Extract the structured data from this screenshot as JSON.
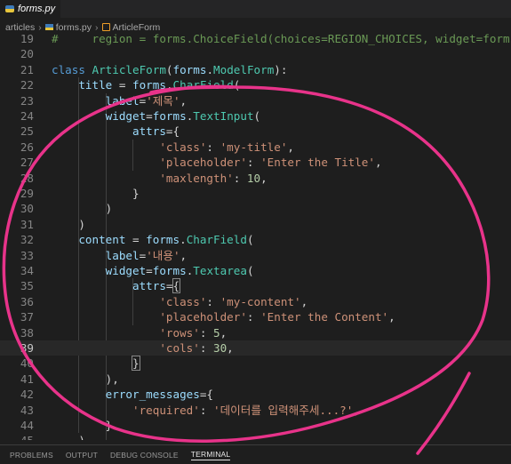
{
  "tab": {
    "label": "forms.py",
    "icon": "python-file-icon"
  },
  "breadcrumb": {
    "folder": "articles",
    "file": "forms.py",
    "symbol": "ArticleForm",
    "separator": "›"
  },
  "code": {
    "lines": [
      {
        "n": "19",
        "tokens": [
          [
            "cm",
            "#     region = forms.ChoiceField(choices=REGION_CHOICES, widget=forms"
          ]
        ]
      },
      {
        "n": "20",
        "tokens": []
      },
      {
        "n": "21",
        "tokens": [
          [
            "kw",
            "class"
          ],
          [
            "pl",
            " "
          ],
          [
            "cls",
            "ArticleForm"
          ],
          [
            "pl",
            "("
          ],
          [
            "var",
            "forms"
          ],
          [
            "pl",
            "."
          ],
          [
            "cls",
            "ModelForm"
          ],
          [
            "pl",
            "):"
          ]
        ]
      },
      {
        "n": "22",
        "tokens": [
          [
            "pl",
            "    "
          ],
          [
            "var",
            "title"
          ],
          [
            "pl",
            " = "
          ],
          [
            "var",
            "forms"
          ],
          [
            "pl",
            "."
          ],
          [
            "cls",
            "CharField"
          ],
          [
            "pl",
            "("
          ]
        ]
      },
      {
        "n": "23",
        "tokens": [
          [
            "pl",
            "        "
          ],
          [
            "var",
            "label"
          ],
          [
            "pl",
            "="
          ],
          [
            "str",
            "'제목'"
          ],
          [
            "pl",
            ","
          ]
        ]
      },
      {
        "n": "24",
        "tokens": [
          [
            "pl",
            "        "
          ],
          [
            "var",
            "widget"
          ],
          [
            "pl",
            "="
          ],
          [
            "var",
            "forms"
          ],
          [
            "pl",
            "."
          ],
          [
            "cls",
            "TextInput"
          ],
          [
            "pl",
            "("
          ]
        ]
      },
      {
        "n": "25",
        "tokens": [
          [
            "pl",
            "            "
          ],
          [
            "var",
            "attrs"
          ],
          [
            "pl",
            "={"
          ]
        ]
      },
      {
        "n": "26",
        "tokens": [
          [
            "pl",
            "                "
          ],
          [
            "str",
            "'class'"
          ],
          [
            "pl",
            ": "
          ],
          [
            "str",
            "'my-title'"
          ],
          [
            "pl",
            ","
          ]
        ]
      },
      {
        "n": "27",
        "tokens": [
          [
            "pl",
            "                "
          ],
          [
            "str",
            "'placeholder'"
          ],
          [
            "pl",
            ": "
          ],
          [
            "str",
            "'Enter the Title'"
          ],
          [
            "pl",
            ","
          ]
        ]
      },
      {
        "n": "28",
        "tokens": [
          [
            "pl",
            "                "
          ],
          [
            "str",
            "'maxlength'"
          ],
          [
            "pl",
            ": "
          ],
          [
            "num",
            "10"
          ],
          [
            "pl",
            ","
          ]
        ]
      },
      {
        "n": "29",
        "tokens": [
          [
            "pl",
            "            }"
          ]
        ]
      },
      {
        "n": "30",
        "tokens": [
          [
            "pl",
            "        )"
          ]
        ]
      },
      {
        "n": "31",
        "tokens": [
          [
            "pl",
            "    )"
          ]
        ]
      },
      {
        "n": "32",
        "tokens": [
          [
            "pl",
            "    "
          ],
          [
            "var",
            "content"
          ],
          [
            "pl",
            " = "
          ],
          [
            "var",
            "forms"
          ],
          [
            "pl",
            "."
          ],
          [
            "cls",
            "CharField"
          ],
          [
            "pl",
            "("
          ]
        ]
      },
      {
        "n": "33",
        "tokens": [
          [
            "pl",
            "        "
          ],
          [
            "var",
            "label"
          ],
          [
            "pl",
            "="
          ],
          [
            "str",
            "'내용'"
          ],
          [
            "pl",
            ","
          ]
        ]
      },
      {
        "n": "34",
        "tokens": [
          [
            "pl",
            "        "
          ],
          [
            "var",
            "widget"
          ],
          [
            "pl",
            "="
          ],
          [
            "var",
            "forms"
          ],
          [
            "pl",
            "."
          ],
          [
            "cls",
            "Textarea"
          ],
          [
            "pl",
            "("
          ]
        ]
      },
      {
        "n": "35",
        "tokens": [
          [
            "pl",
            "            "
          ],
          [
            "var",
            "attrs"
          ],
          [
            "pl",
            "="
          ],
          [
            "brk",
            "{"
          ]
        ]
      },
      {
        "n": "36",
        "tokens": [
          [
            "pl",
            "                "
          ],
          [
            "str",
            "'class'"
          ],
          [
            "pl",
            ": "
          ],
          [
            "str",
            "'my-content'"
          ],
          [
            "pl",
            ","
          ]
        ]
      },
      {
        "n": "37",
        "tokens": [
          [
            "pl",
            "                "
          ],
          [
            "str",
            "'placeholder'"
          ],
          [
            "pl",
            ": "
          ],
          [
            "str",
            "'Enter the Content'"
          ],
          [
            "pl",
            ","
          ]
        ]
      },
      {
        "n": "38",
        "tokens": [
          [
            "pl",
            "                "
          ],
          [
            "str",
            "'rows'"
          ],
          [
            "pl",
            ": "
          ],
          [
            "num",
            "5"
          ],
          [
            "pl",
            ","
          ]
        ]
      },
      {
        "n": "39",
        "tokens": [
          [
            "pl",
            "                "
          ],
          [
            "str",
            "'cols'"
          ],
          [
            "pl",
            ": "
          ],
          [
            "num",
            "30"
          ],
          [
            "pl",
            ","
          ]
        ],
        "current": true
      },
      {
        "n": "40",
        "tokens": [
          [
            "pl",
            "            "
          ],
          [
            "brk",
            "}"
          ]
        ]
      },
      {
        "n": "41",
        "tokens": [
          [
            "pl",
            "        ),"
          ]
        ]
      },
      {
        "n": "42",
        "tokens": [
          [
            "pl",
            "        "
          ],
          [
            "var",
            "error_messages"
          ],
          [
            "pl",
            "={"
          ]
        ]
      },
      {
        "n": "43",
        "tokens": [
          [
            "pl",
            "            "
          ],
          [
            "str",
            "'required'"
          ],
          [
            "pl",
            ": "
          ],
          [
            "str",
            "'데이터를 입력해주세...?'"
          ],
          [
            "pl",
            ","
          ]
        ]
      },
      {
        "n": "44",
        "tokens": [
          [
            "pl",
            "        }"
          ]
        ]
      },
      {
        "n": "45",
        "tokens": [
          [
            "pl",
            "    )"
          ]
        ]
      }
    ]
  },
  "panel": {
    "tabs": [
      "PROBLEMS",
      "OUTPUT",
      "DEBUG CONSOLE",
      "TERMINAL"
    ],
    "active": "TERMINAL"
  },
  "annotation": {
    "color": "#e8338a"
  }
}
